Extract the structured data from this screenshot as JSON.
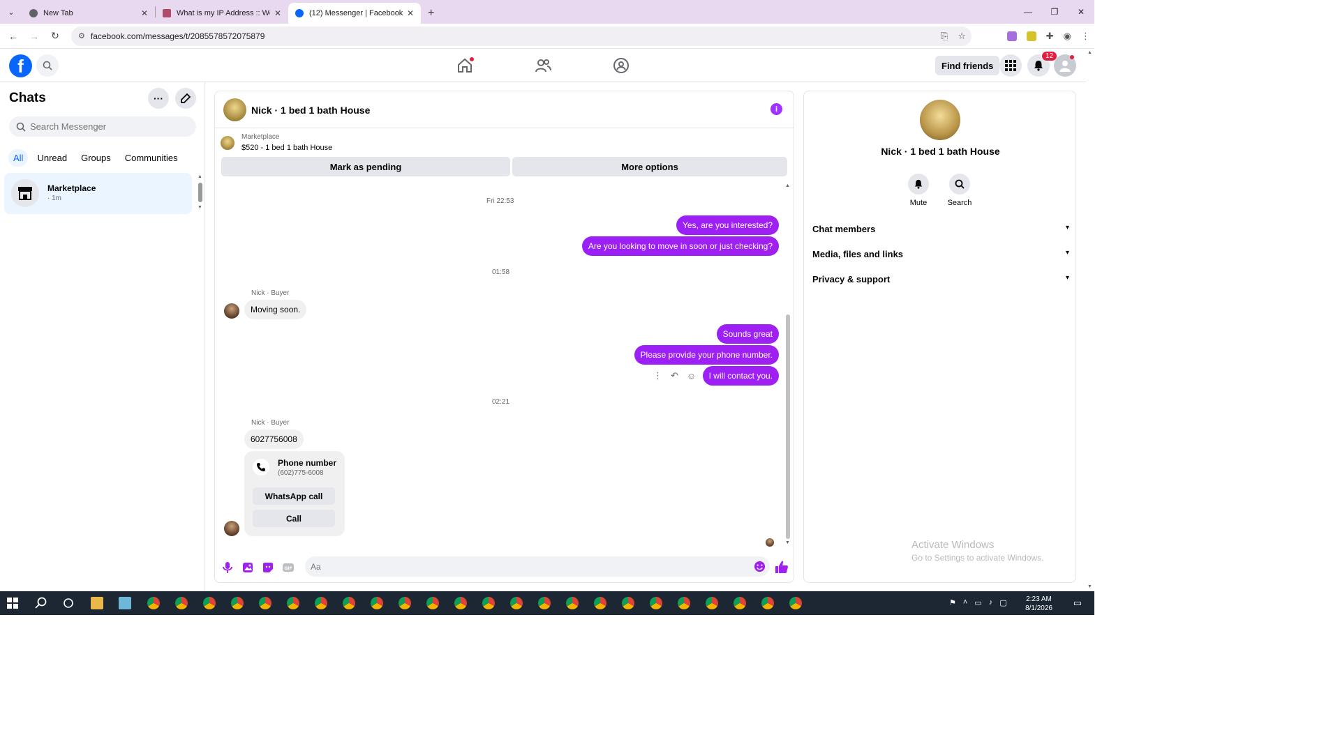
{
  "browser": {
    "tabs": [
      {
        "title": "New Tab",
        "active": false
      },
      {
        "title": "What is my IP Address :: WebBr",
        "active": false
      },
      {
        "title": "(12) Messenger | Facebook",
        "active": true
      }
    ],
    "url": "facebook.com/messages/t/2085578572075879"
  },
  "fb_header": {
    "find_friends": "Find friends",
    "notification_count": "12"
  },
  "chats": {
    "title": "Chats",
    "search_placeholder": "Search Messenger",
    "filters": [
      "All",
      "Unread",
      "Groups",
      "Communities"
    ],
    "items": [
      {
        "name": "Marketplace",
        "time": "· 1m"
      }
    ]
  },
  "conversation": {
    "title": "Nick · 1 bed 1 bath House",
    "marketplace_label": "Marketplace",
    "listing": "$520 - 1 bed 1 bath House",
    "mark_pending": "Mark as pending",
    "more_options": "More options",
    "stamp1": "Fri 22:53",
    "out1": "Yes, are you interested?",
    "out2": "Are you looking to move in soon or just checking?",
    "stamp2": "01:58",
    "sender1": "Nick · Buyer",
    "in1": "Moving soon.",
    "out3": "Sounds great",
    "out4": "Please provide your phone number.",
    "out5": "I will contact you.",
    "stamp3": "02:21",
    "sender2": "Nick · Buyer",
    "in2": "6027756008",
    "phone_card": {
      "title": "Phone number",
      "number": "(602)775-6008",
      "whatsapp": "WhatsApp call",
      "call": "Call"
    },
    "composer_placeholder": "Aa"
  },
  "info_panel": {
    "name": "Nick · 1 bed 1 bath House",
    "mute": "Mute",
    "search": "Search",
    "sections": [
      "Chat members",
      "Media, files and links",
      "Privacy & support"
    ]
  },
  "watermark": {
    "line1": "Activate Windows",
    "line2": "Go to Settings to activate Windows."
  },
  "taskbar": {
    "time": "2:23 AM",
    "date": "8/1/2026"
  },
  "colors": {
    "fb_blue": "#0866ff",
    "outgoing_bubble": "#a020f0",
    "incoming_bubble": "#f0f0f0"
  }
}
